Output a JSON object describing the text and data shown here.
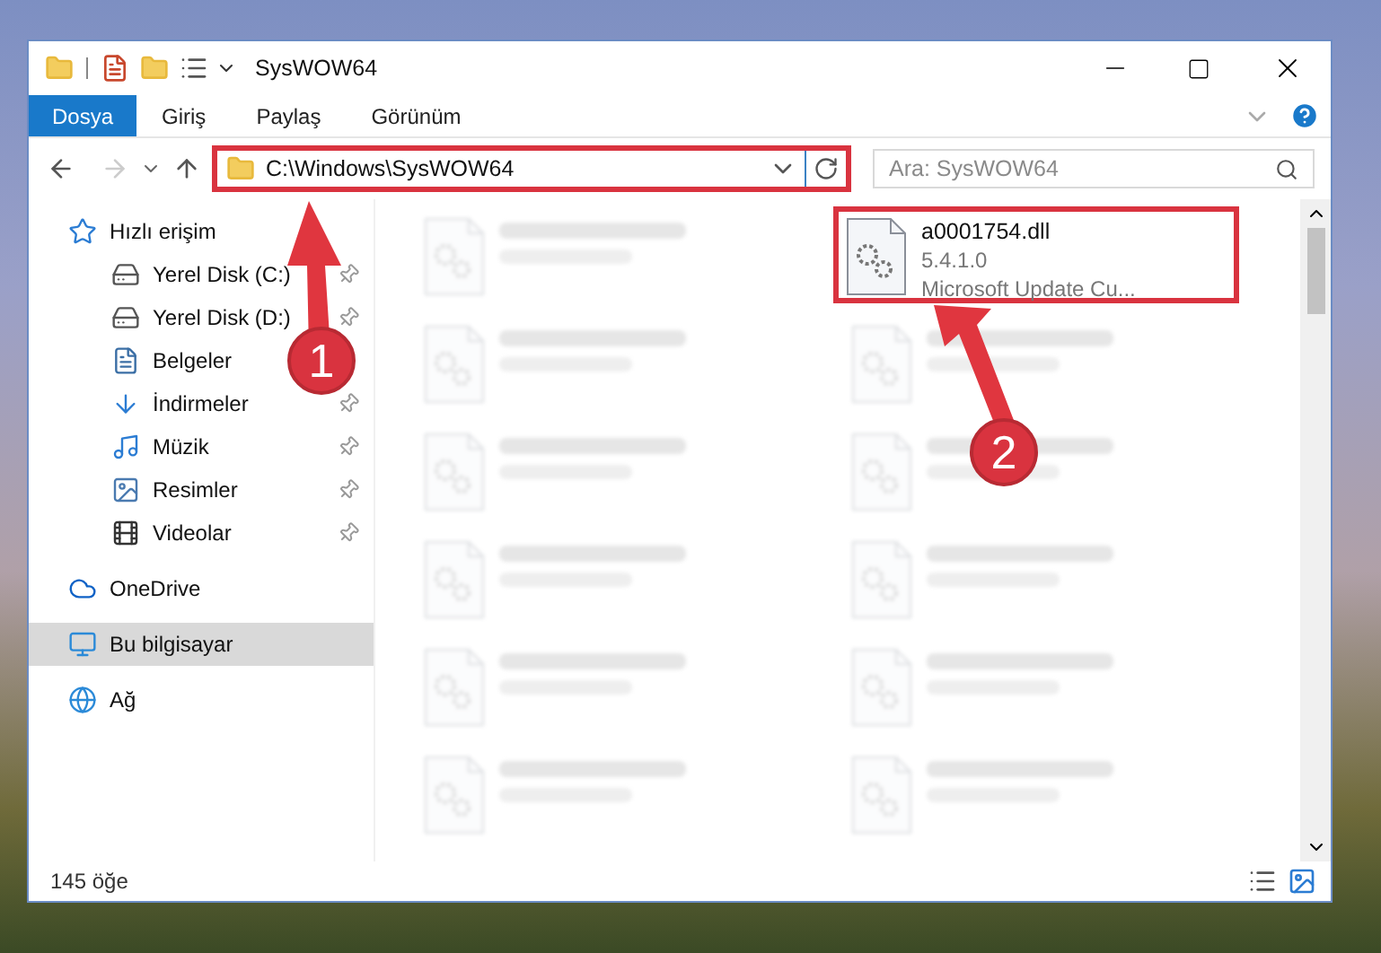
{
  "window": {
    "title": "SysWOW64"
  },
  "ribbon_tabs": [
    {
      "label": "Dosya",
      "kind": "file"
    },
    {
      "label": "Giriş",
      "kind": "tab"
    },
    {
      "label": "Paylaş",
      "kind": "tab"
    },
    {
      "label": "Görünüm",
      "kind": "tab"
    }
  ],
  "address_bar": {
    "value": "C:\\Windows\\SysWOW64",
    "highlighted": true
  },
  "search": {
    "placeholder": "Ara: SysWOW64"
  },
  "sidebar": {
    "items": [
      {
        "label": "Hızlı erişim",
        "selected": false,
        "children": [
          {
            "label": "Yerel Disk (C:)",
            "pinned": true
          },
          {
            "label": "Yerel Disk (D:)",
            "pinned": true
          },
          {
            "label": "Belgeler"
          },
          {
            "label": "İndirmeler",
            "pinned": true
          },
          {
            "label": "Müzik",
            "pinned": true
          },
          {
            "label": "Resimler",
            "pinned": true
          },
          {
            "label": "Videolar",
            "pinned": true
          }
        ]
      },
      {
        "label": "OneDrive",
        "selected": false
      },
      {
        "label": "Bu bilgisayar",
        "selected": true
      },
      {
        "label": "Ağ",
        "selected": false
      }
    ]
  },
  "files": [
    {
      "kind": "blurred",
      "selected": false
    },
    {
      "kind": "file",
      "name": "a0001754.dll",
      "version": "5.4.1.0",
      "type": "Microsoft Update Cu...",
      "selected": true
    },
    {
      "kind": "blurred",
      "selected": false
    },
    {
      "kind": "blurred",
      "selected": false
    },
    {
      "kind": "blurred",
      "selected": false
    },
    {
      "kind": "blurred",
      "selected": false
    },
    {
      "kind": "blurred",
      "selected": false
    },
    {
      "kind": "blurred",
      "selected": false
    },
    {
      "kind": "blurred",
      "selected": false
    },
    {
      "kind": "blurred",
      "selected": false
    },
    {
      "kind": "blurred",
      "selected": false
    },
    {
      "kind": "blurred",
      "selected": false
    }
  ],
  "status_bar": {
    "item_count": "145 öğe"
  },
  "annotations": [
    {
      "label": "1"
    },
    {
      "label": "2"
    }
  ]
}
